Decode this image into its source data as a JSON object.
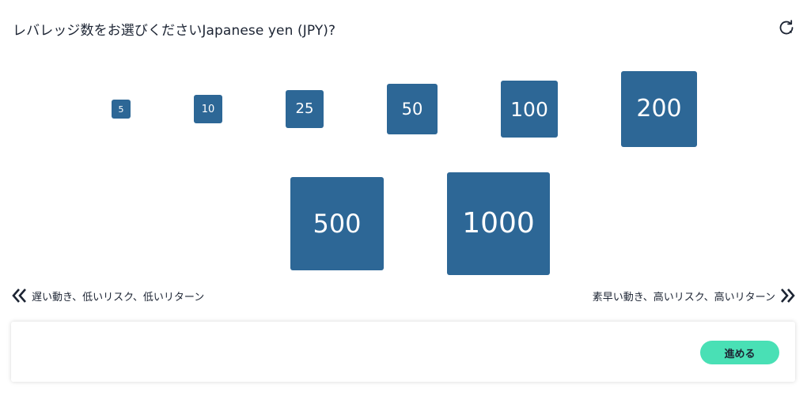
{
  "question": {
    "title": "レバレッジ数をお選びくださいJapanese yen (JPY)?"
  },
  "controls": {
    "reset_icon": "refresh-icon"
  },
  "leverage_options": [
    {
      "label": "5"
    },
    {
      "label": "10"
    },
    {
      "label": "25"
    },
    {
      "label": "50"
    },
    {
      "label": "100"
    },
    {
      "label": "200"
    },
    {
      "label": "500"
    },
    {
      "label": "1000"
    }
  ],
  "scale": {
    "low_label": "遅い動き、低いリスク、低いリターン",
    "high_label": "素早い動き、高いリスク、高いリターン",
    "low_icon": "double-chevron-left-icon",
    "high_icon": "double-chevron-right-icon"
  },
  "footer": {
    "proceed_label": "進める"
  },
  "colors": {
    "tile": "#2d6796",
    "accent": "#49e0b5",
    "text": "#1c2433"
  }
}
